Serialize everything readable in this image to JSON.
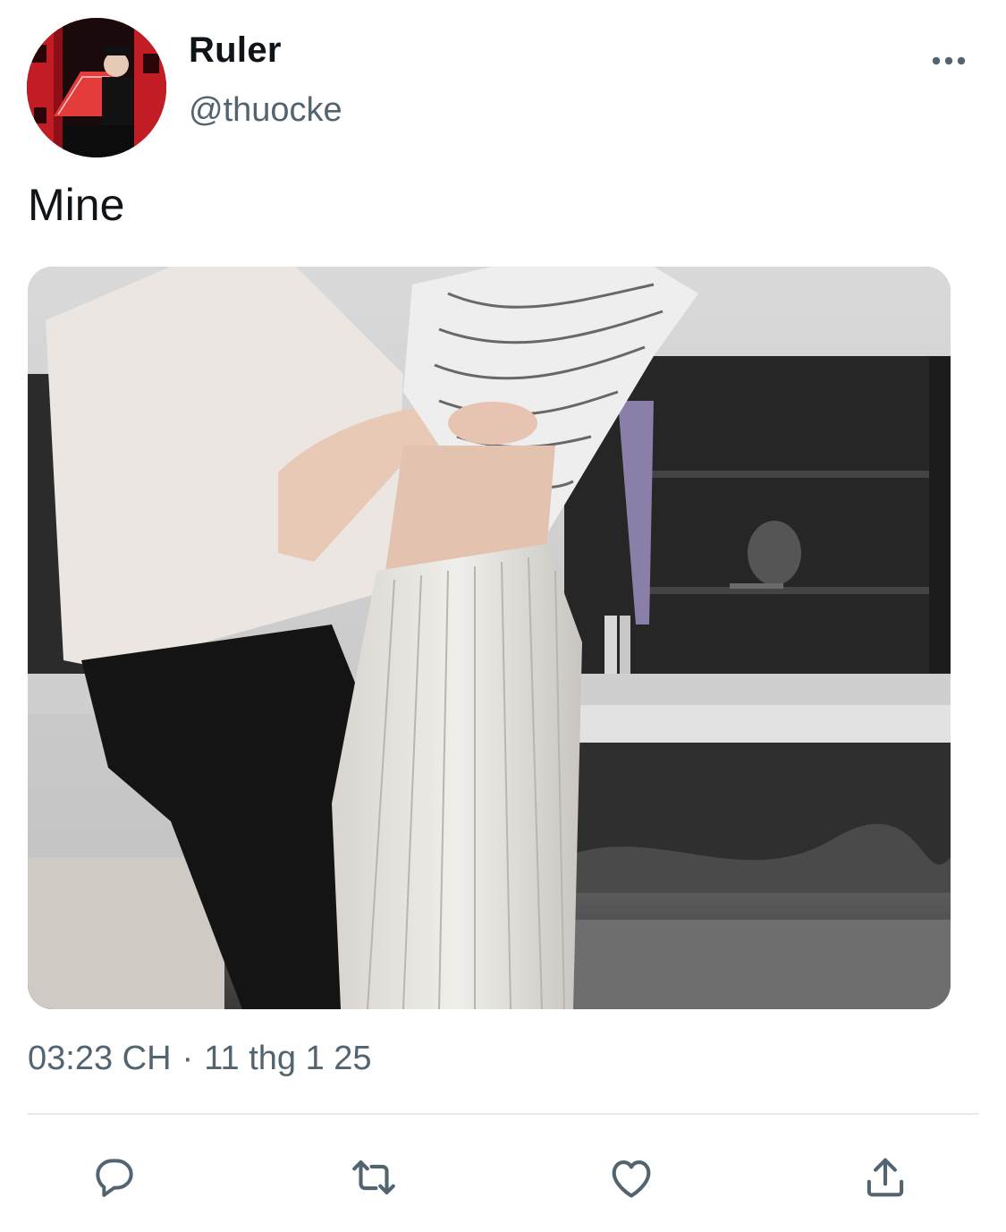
{
  "author": {
    "display_name": "Ruler",
    "handle": "@thuocke"
  },
  "tweet": {
    "text": "Mine",
    "time": "03:23 CH",
    "separator": "·",
    "date": "11 thg 1 25"
  },
  "icons": {
    "more": "more-horizontal-icon",
    "reply": "reply-icon",
    "retweet": "retweet-icon",
    "like": "heart-icon",
    "share": "share-icon"
  },
  "colors": {
    "text_primary": "#0f1419",
    "text_secondary": "#536471",
    "divider": "#e6ebee",
    "avatar_bg": "#b01a22"
  }
}
